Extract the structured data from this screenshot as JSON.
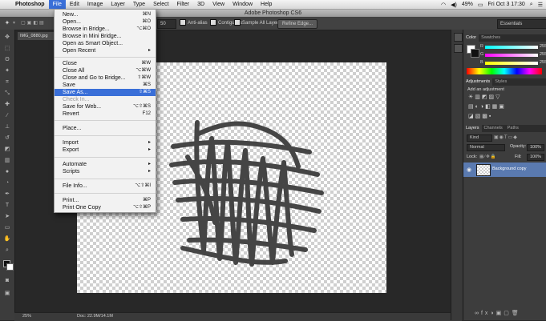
{
  "menubar": {
    "app_name": "Photoshop",
    "items": [
      "File",
      "Edit",
      "Image",
      "Layer",
      "Type",
      "Select",
      "Filter",
      "3D",
      "View",
      "Window",
      "Help"
    ],
    "battery": "49%",
    "clock": "Fri Oct 3  17:30"
  },
  "window": {
    "title": "Adobe Photoshop CS6"
  },
  "options": {
    "value": "50",
    "anti_alias": "Anti-alias",
    "contiguous": "Contiguous",
    "sample_all": "Sample All Layers",
    "refine_edge": "Refine Edge...",
    "workspace": "Essentials"
  },
  "document": {
    "tab": "IMG_0880.jpg",
    "zoom": "25%",
    "doc_size": "Doc: 22.9M/14.1M"
  },
  "file_menu": {
    "new": "New...",
    "new_sc": "⌘N",
    "open": "Open...",
    "open_sc": "⌘O",
    "browse_bridge": "Browse in Bridge...",
    "browse_bridge_sc": "⌥⌘O",
    "browse_mini": "Browse in Mini Bridge...",
    "open_smart": "Open as Smart Object...",
    "open_recent": "Open Recent",
    "close": "Close",
    "close_sc": "⌘W",
    "close_all": "Close All",
    "close_all_sc": "⌥⌘W",
    "close_bridge": "Close and Go to Bridge...",
    "close_bridge_sc": "⇧⌘W",
    "save": "Save",
    "save_sc": "⌘S",
    "save_as": "Save As...",
    "save_as_sc": "⇧⌘S",
    "check_in": "Check In...",
    "save_web": "Save for Web...",
    "save_web_sc": "⌥⇧⌘S",
    "revert": "Revert",
    "revert_sc": "F12",
    "place": "Place...",
    "import": "Import",
    "export": "Export",
    "automate": "Automate",
    "scripts": "Scripts",
    "file_info": "File Info...",
    "file_info_sc": "⌥⇧⌘I",
    "print": "Print...",
    "print_sc": "⌘P",
    "print_one": "Print One Copy",
    "print_one_sc": "⌥⇧⌘P"
  },
  "color_panel": {
    "tabs": [
      "Color",
      "Swatches"
    ],
    "r_label": "R",
    "g_label": "G",
    "b_label": "B",
    "r": "255",
    "g": "255",
    "b": "255"
  },
  "adjustments_panel": {
    "tabs": [
      "Adjustments",
      "Styles"
    ],
    "heading": "Add an adjustment"
  },
  "layers_panel": {
    "tabs": [
      "Layers",
      "Channels",
      "Paths"
    ],
    "kind": "Kind",
    "blend_mode": "Normal",
    "opacity_label": "Opacity:",
    "opacity": "100%",
    "lock_label": "Lock:",
    "fill_label": "Fill:",
    "fill": "100%",
    "layer_name": "Background copy"
  },
  "colors": {
    "menu_highlight": "#3a6fd8",
    "panel": "#3d3d3d",
    "stroke": "#444444"
  }
}
